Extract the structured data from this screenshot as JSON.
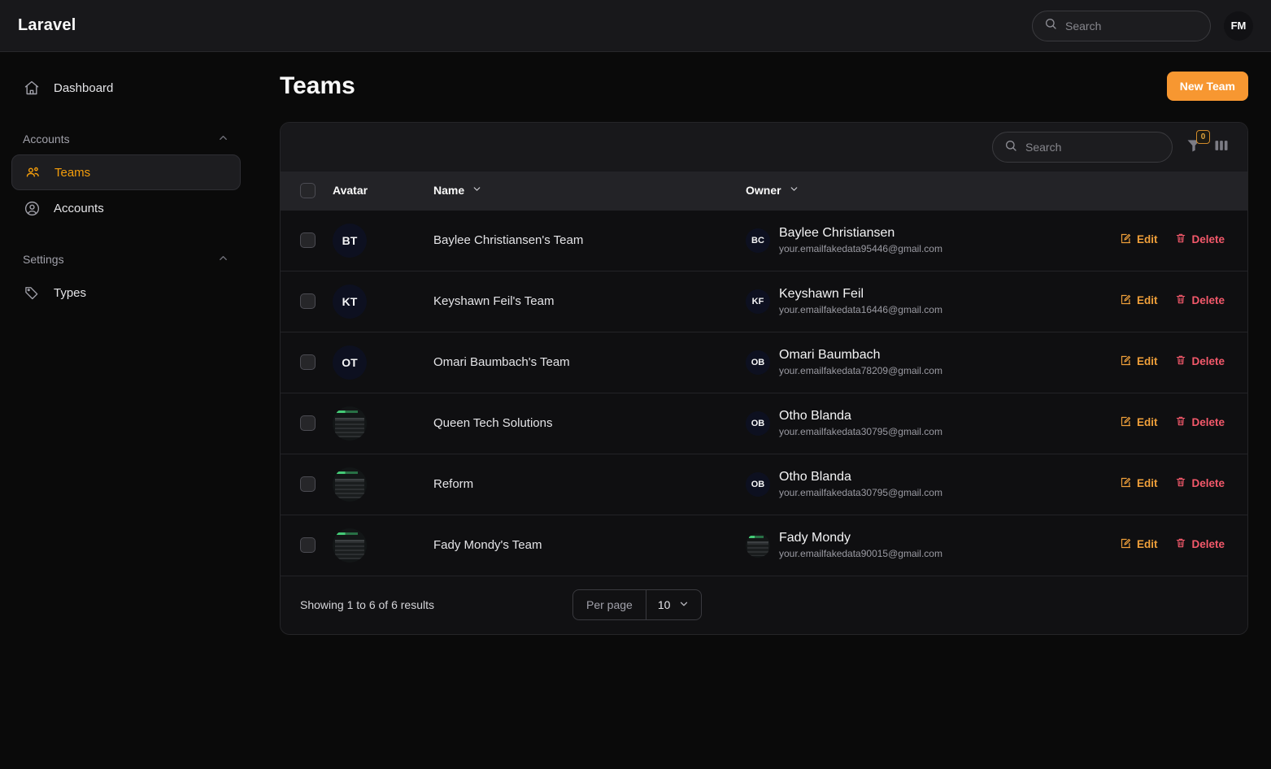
{
  "app": {
    "brand": "Laravel",
    "header_search_placeholder": "Search",
    "user_initials": "FM"
  },
  "sidebar": {
    "dashboard": {
      "label": "Dashboard",
      "icon": "home-icon"
    },
    "groups": [
      {
        "label": "Accounts",
        "items": [
          {
            "label": "Teams",
            "icon": "users-icon",
            "active": true
          },
          {
            "label": "Accounts",
            "icon": "user-circle-icon",
            "active": false
          }
        ]
      },
      {
        "label": "Settings",
        "items": [
          {
            "label": "Types",
            "icon": "tag-icon",
            "active": false
          }
        ]
      }
    ]
  },
  "page": {
    "title": "Teams",
    "new_button": "New Team"
  },
  "toolbar": {
    "search_placeholder": "Search",
    "filter_badge": "0",
    "filter_icon": "funnel-icon",
    "columns_icon": "columns-icon"
  },
  "table": {
    "headers": {
      "avatar": "Avatar",
      "name": "Name",
      "owner": "Owner"
    },
    "rows": [
      {
        "avatar_initials": "BT",
        "avatar_type": "initials",
        "name": "Baylee Christiansen's Team",
        "owner_initials": "BC",
        "owner_avatar_type": "initials",
        "owner_name": "Baylee Christiansen",
        "owner_email": "your.emailfakedata95446@gmail.com",
        "edit": "Edit",
        "delete": "Delete"
      },
      {
        "avatar_initials": "KT",
        "avatar_type": "initials",
        "name": "Keyshawn Feil's Team",
        "owner_initials": "KF",
        "owner_avatar_type": "initials",
        "owner_name": "Keyshawn Feil",
        "owner_email": "your.emailfakedata16446@gmail.com",
        "edit": "Edit",
        "delete": "Delete"
      },
      {
        "avatar_initials": "OT",
        "avatar_type": "initials",
        "name": "Omari Baumbach's Team",
        "owner_initials": "OB",
        "owner_avatar_type": "initials",
        "owner_name": "Omari Baumbach",
        "owner_email": "your.emailfakedata78209@gmail.com",
        "edit": "Edit",
        "delete": "Delete"
      },
      {
        "avatar_initials": "",
        "avatar_type": "image",
        "name": "Queen Tech Solutions",
        "owner_initials": "OB",
        "owner_avatar_type": "initials",
        "owner_name": "Otho Blanda",
        "owner_email": "your.emailfakedata30795@gmail.com",
        "edit": "Edit",
        "delete": "Delete"
      },
      {
        "avatar_initials": "",
        "avatar_type": "image",
        "name": "Reform",
        "owner_initials": "OB",
        "owner_avatar_type": "initials",
        "owner_name": "Otho Blanda",
        "owner_email": "your.emailfakedata30795@gmail.com",
        "edit": "Edit",
        "delete": "Delete"
      },
      {
        "avatar_initials": "",
        "avatar_type": "image",
        "name": "Fady Mondy's Team",
        "owner_initials": "",
        "owner_avatar_type": "image",
        "owner_name": "Fady Mondy",
        "owner_email": "your.emailfakedata90015@gmail.com",
        "edit": "Edit",
        "delete": "Delete"
      }
    ]
  },
  "footer": {
    "showing": "Showing 1 to 6 of 6 results",
    "per_page_label": "Per page",
    "per_page_value": "10"
  },
  "colors": {
    "accent": "#f79731",
    "edit": "#f0a03a",
    "delete": "#f4596b",
    "sidebar_active_text": "#f59e0b",
    "page_bg": "#0a0a0a",
    "card_bg": "#111113",
    "topbar_bg": "#18181b"
  }
}
